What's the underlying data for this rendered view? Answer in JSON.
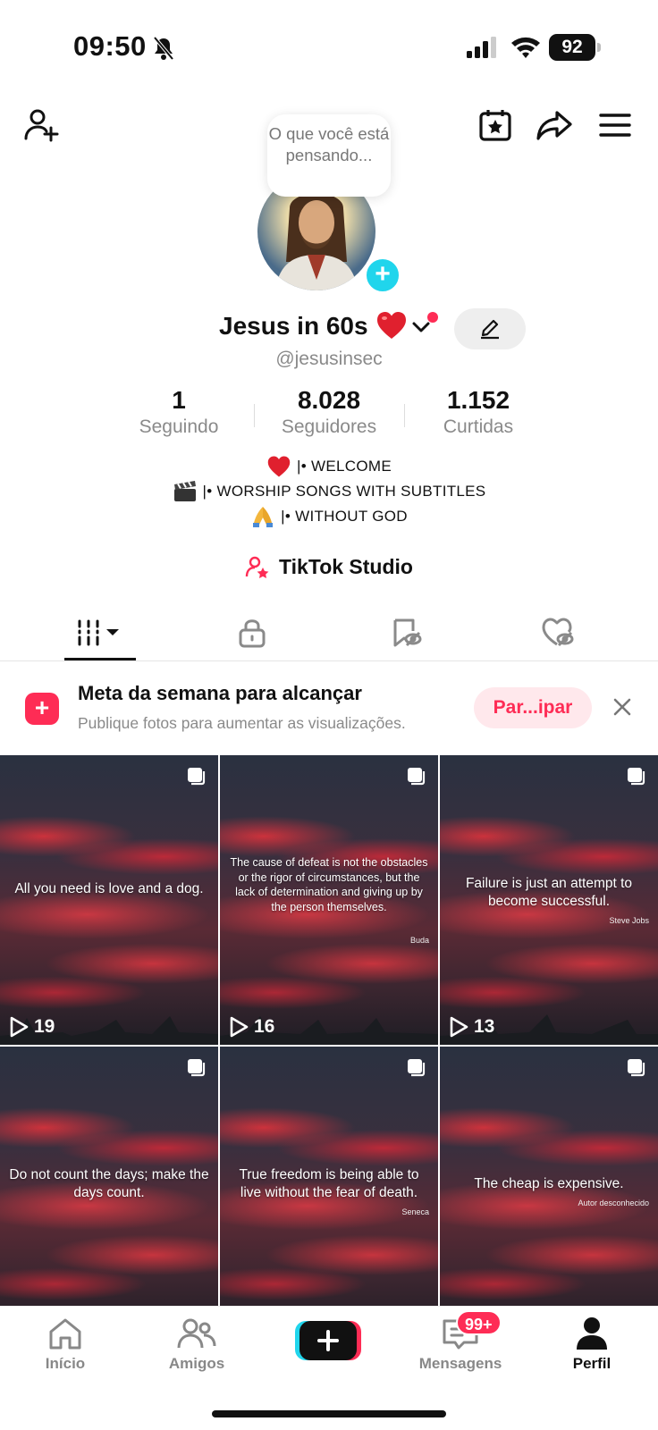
{
  "status_bar": {
    "time": "09:50",
    "battery": "92"
  },
  "profile": {
    "thought_bubble": "O que você está pensando...",
    "name": "Jesus in 60s",
    "handle": "@jesusinsec",
    "stats": [
      {
        "value": "1",
        "label": "Seguindo"
      },
      {
        "value": "8.028",
        "label": "Seguidores"
      },
      {
        "value": "1.152",
        "label": "Curtidas"
      }
    ],
    "bio": [
      {
        "emoji": "heart-emoji",
        "text": "|• WELCOME"
      },
      {
        "emoji": "clapperboard-emoji",
        "text": "|• WORSHIP SONGS WITH SUBTITLES"
      },
      {
        "emoji": "praying-hands-emoji",
        "text": "|• WITHOUT GOD"
      }
    ],
    "studio_label": "TikTok Studio"
  },
  "goal": {
    "title": "Meta da semana para alcançar",
    "subtitle": "Publique fotos para aumentar as visualizações.",
    "button": "Par...ipar"
  },
  "videos": [
    {
      "text": "All you need is love and a dog.",
      "author": "",
      "views": "19"
    },
    {
      "text": "The cause of defeat is not the obstacles or the rigor of circumstances, but the lack of determination and giving up by the person themselves.",
      "author": "Buda",
      "views": "16"
    },
    {
      "text": "Failure is just an attempt to become successful.",
      "author": "Steve Jobs",
      "views": "13"
    },
    {
      "text": "Do not count the days; make the days count.",
      "author": "",
      "views": ""
    },
    {
      "text": "True freedom is being able to live without the fear of death.",
      "author": "Seneca",
      "views": ""
    },
    {
      "text": "The cheap is expensive.",
      "author": "Autor desconhecido",
      "views": ""
    }
  ],
  "bottom_nav": {
    "home": "Início",
    "friends": "Amigos",
    "messages": "Mensagens",
    "messages_badge": "99+",
    "profile": "Perfil"
  },
  "colors": {
    "accent": "#fe2c55",
    "cyan": "#20d5ec"
  }
}
